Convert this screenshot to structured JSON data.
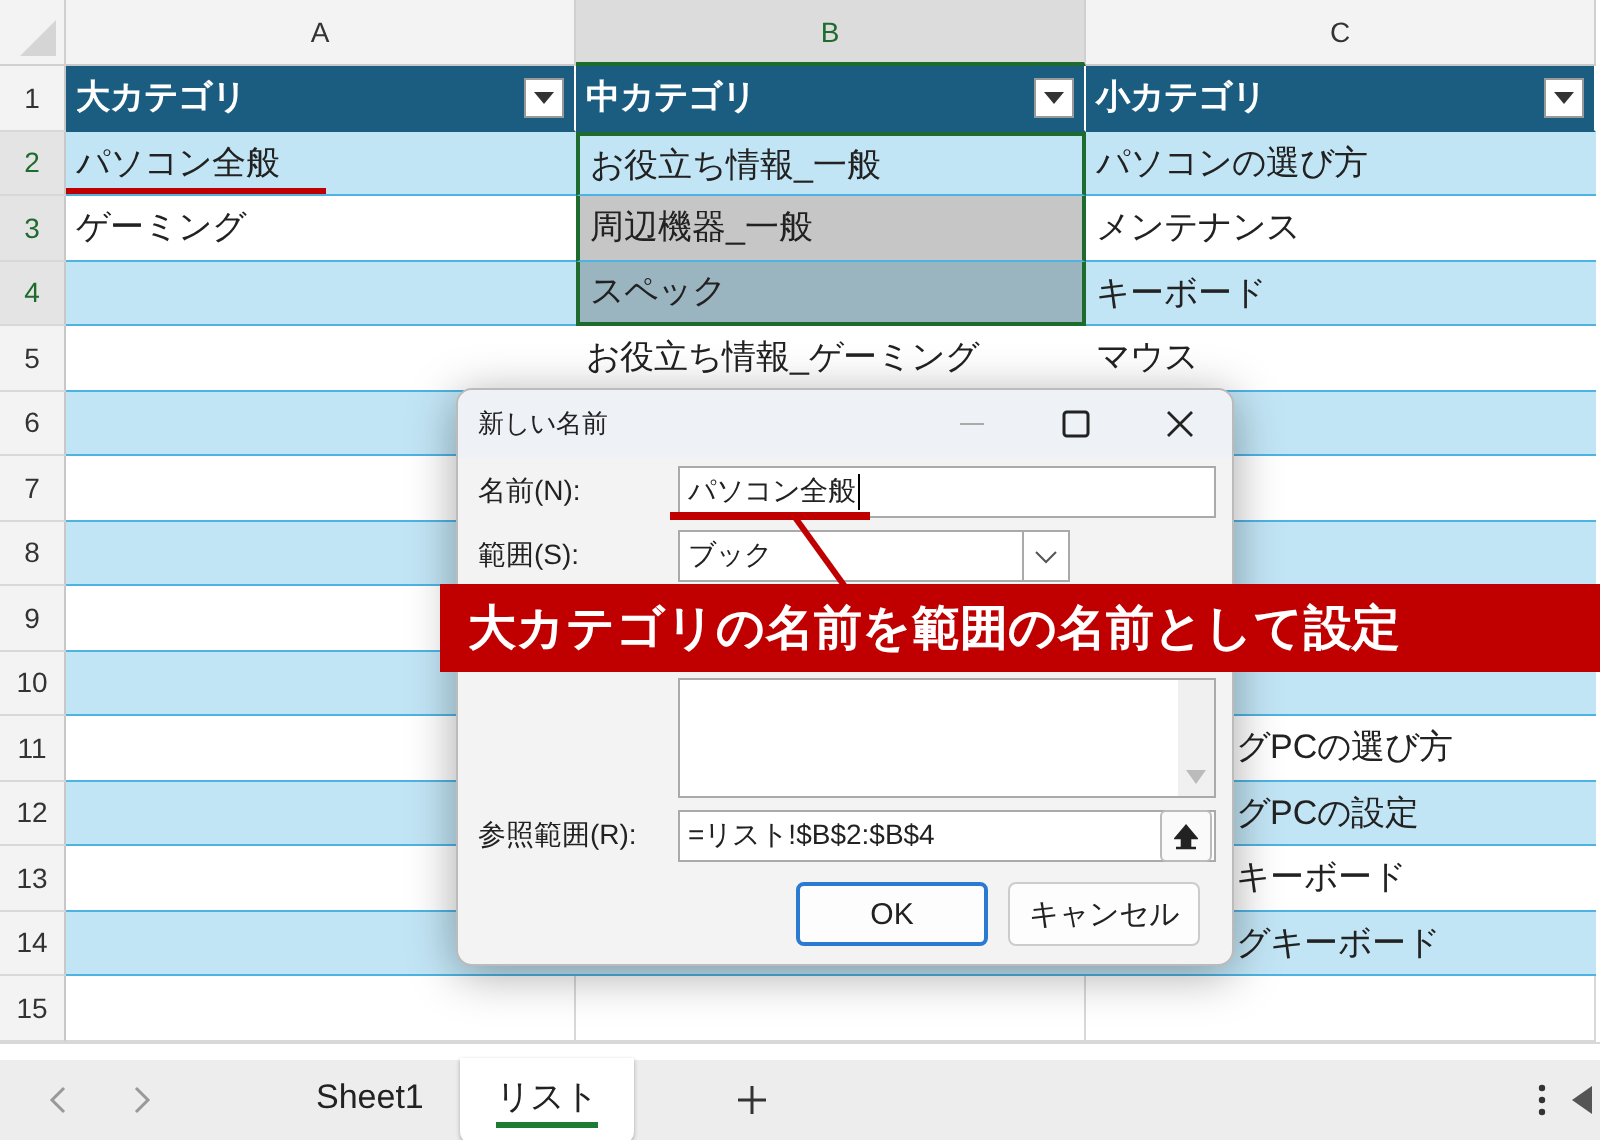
{
  "columns": [
    {
      "label": "A",
      "selected": false
    },
    {
      "label": "B",
      "selected": true
    },
    {
      "label": "C",
      "selected": false
    }
  ],
  "rows": [
    {
      "number": "1",
      "kind": "header",
      "selected": false,
      "cells": [
        {
          "text": "大カテゴリ",
          "selected": false
        },
        {
          "text": "中カテゴリ",
          "selected": false
        },
        {
          "text": "小カテゴリ",
          "selected": false
        }
      ]
    },
    {
      "number": "2",
      "kind": "banded",
      "selected": true,
      "cells": [
        {
          "text": "パソコン全般",
          "selected": false
        },
        {
          "text": "お役立ち情報_一般",
          "selected": true
        },
        {
          "text": "パソコンの選び方",
          "selected": false
        }
      ]
    },
    {
      "number": "3",
      "kind": "plain",
      "selected": true,
      "cells": [
        {
          "text": "ゲーミング",
          "selected": false
        },
        {
          "text": "周辺機器_一般",
          "selected": true
        },
        {
          "text": "メンテナンス",
          "selected": false
        }
      ]
    },
    {
      "number": "4",
      "kind": "banded",
      "selected": true,
      "cells": [
        {
          "selected": false
        },
        {
          "text": "スペック",
          "selected": true
        },
        {
          "text": "キーボード",
          "selected": false
        }
      ]
    },
    {
      "number": "5",
      "kind": "plain",
      "selected": false,
      "cells": [
        {
          "selected": false
        },
        {
          "text": "お役立ち情報_ゲーミング",
          "selected": false
        },
        {
          "text": "マウス",
          "selected": false
        }
      ]
    },
    {
      "number": "6",
      "kind": "banded",
      "selected": false,
      "cells": [
        {},
        null,
        {}
      ]
    },
    {
      "number": "7",
      "kind": "plain",
      "selected": false,
      "cells": [
        {},
        null,
        {}
      ]
    },
    {
      "number": "8",
      "kind": "banded",
      "selected": false,
      "cells": [
        {},
        null,
        {}
      ]
    },
    {
      "number": "9",
      "kind": "plain",
      "selected": false,
      "cells": [
        {},
        null,
        {}
      ]
    },
    {
      "number": "10",
      "kind": "banded",
      "selected": false,
      "cells": [
        {},
        null,
        {}
      ]
    },
    {
      "number": "11",
      "kind": "plain",
      "selected": false,
      "cells": [
        {},
        null,
        {
          "text": "グPCの選び方",
          "covered": true
        }
      ]
    },
    {
      "number": "12",
      "kind": "banded",
      "selected": false,
      "cells": [
        {},
        null,
        {
          "text": "グPCの設定",
          "covered": true
        }
      ]
    },
    {
      "number": "13",
      "kind": "plain",
      "selected": false,
      "cells": [
        {},
        null,
        {
          "text": "キーボード",
          "covered": true
        }
      ]
    },
    {
      "number": "14",
      "kind": "banded",
      "selected": false,
      "cells": [
        {},
        {},
        {
          "text": "グキーボード",
          "covered": true
        }
      ]
    },
    {
      "number": "15",
      "kind": "empty",
      "selected": false,
      "cells": [
        {},
        {},
        {}
      ]
    }
  ],
  "dialog": {
    "title": "新しい名前",
    "fields": [
      {
        "kind": "text",
        "label": "名前(N):",
        "value": "パソコン全般"
      },
      {
        "kind": "combo",
        "label": "範囲(S):",
        "value": "ブック"
      },
      {
        "kind": "area"
      },
      {
        "kind": "ref",
        "label": "参照範囲(R):",
        "value": "=リスト!$B$2:$B$4"
      }
    ],
    "buttons": [
      {
        "label": "OK",
        "default": true
      },
      {
        "label": "キャンセル",
        "default": false
      }
    ]
  },
  "callout": {
    "text": "大カテゴリの名前を範囲の名前として設定"
  },
  "sheet_tabs": [
    {
      "label": "Sheet1",
      "selected": false
    },
    {
      "label": "リスト",
      "selected": true
    }
  ]
}
